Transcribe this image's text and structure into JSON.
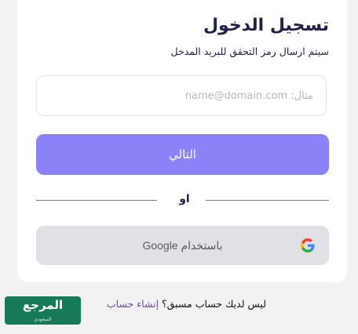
{
  "login": {
    "title": "تسجيل الدخول",
    "subtitle": "سيتم ارسال رمز التحقق للبريد المدخل",
    "email_placeholder": "مثال: name@domain.com",
    "next_label": "التالي",
    "or_label": "او",
    "google_label": "باستخدام Google",
    "google_icon": "google-icon"
  },
  "footer": {
    "question": "ليس لديك حساب مسبق؟",
    "signup_link": "إنشاء حساب"
  },
  "logo": {
    "main": "المرجع",
    "sub": "السعودي"
  }
}
